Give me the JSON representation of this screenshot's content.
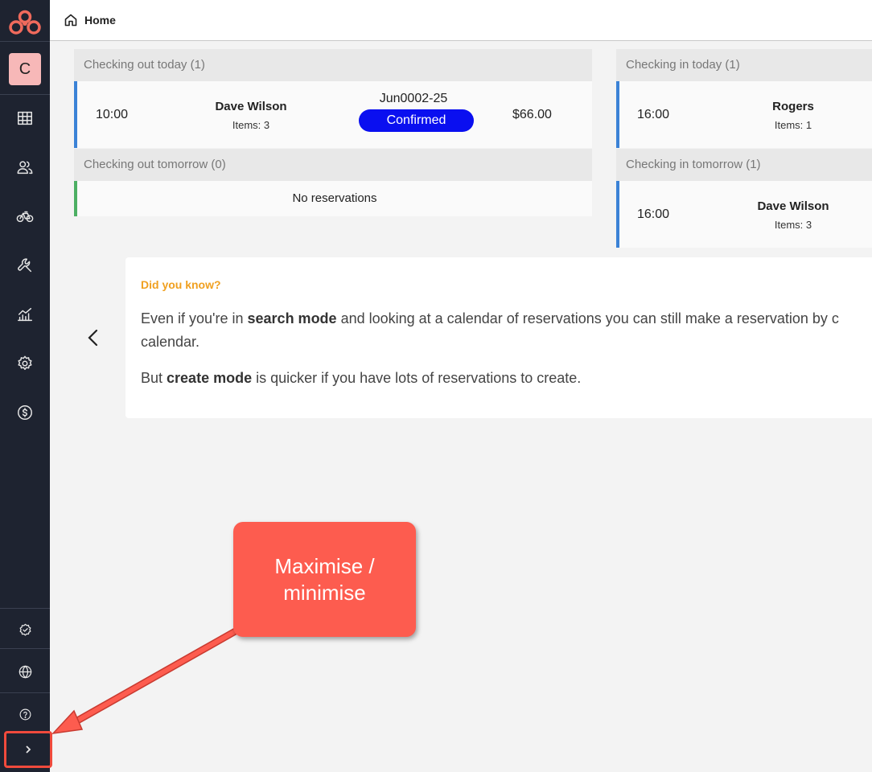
{
  "app": {
    "breadcrumb": "Home",
    "avatar_initial": "C"
  },
  "checkout_today": {
    "heading": "Checking out today (1)",
    "row": {
      "time": "10:00",
      "name": "Dave Wilson",
      "items": "Items: 3",
      "ref": "Jun0002-25",
      "status": "Confirmed",
      "price": "$66.00"
    }
  },
  "checkout_tomorrow": {
    "heading": "Checking out tomorrow (0)",
    "empty": "No reservations"
  },
  "checkin_today": {
    "heading": "Checking in today (1)",
    "row": {
      "time": "16:00",
      "name": "Rogers",
      "items": "Items: 1"
    }
  },
  "checkin_tomorrow": {
    "heading": "Checking in tomorrow (1)",
    "row": {
      "time": "16:00",
      "name": "Dave Wilson",
      "items": "Items: 3"
    }
  },
  "tip": {
    "title": "Did you know?",
    "line1_a": "Even if you're in ",
    "line1_b": "search mode",
    "line1_c": " and looking at a calendar of reservations you can still make a reservation by c",
    "line2": "calendar.",
    "line3_a": "But ",
    "line3_b": "create mode",
    "line3_c": " is quicker if you have lots of reservations to create."
  },
  "callout": {
    "text": "Maximise / minimise"
  },
  "colors": {
    "sidebar": "#1e2330",
    "accent_blue": "#3b82d6",
    "confirmed_badge": "#0a0ff0",
    "empty_green": "#4caf63",
    "tip_title": "#f0a020",
    "callout": "#fd5c4f"
  },
  "icons": {
    "nav": [
      "grid-icon",
      "users-icon",
      "bike-icon",
      "wrench-icon",
      "analytics-icon",
      "settings-icon",
      "billing-icon"
    ],
    "bottom": [
      "verified-icon",
      "globe-icon",
      "help-icon",
      "chevron-right-icon"
    ]
  }
}
